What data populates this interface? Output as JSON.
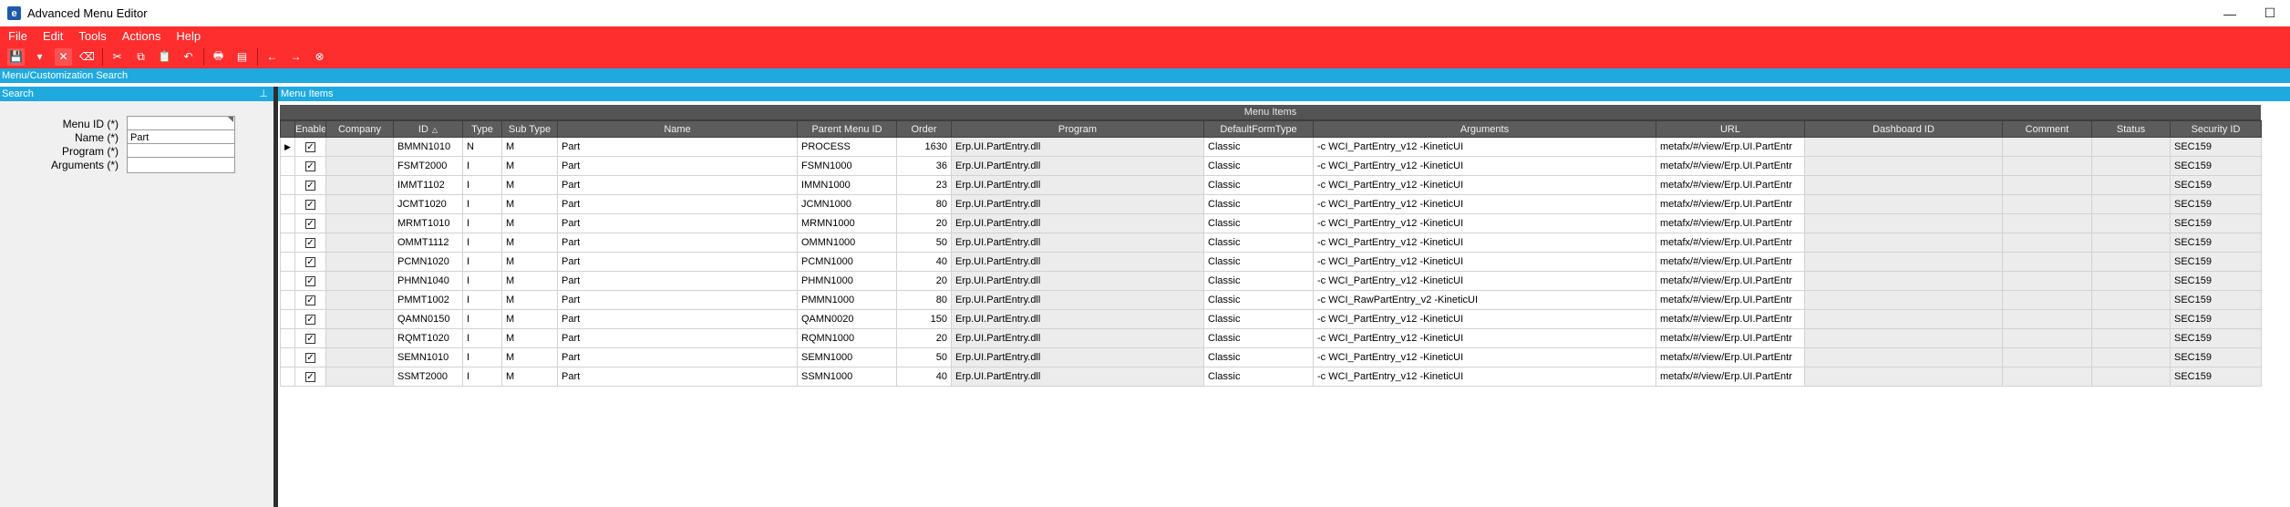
{
  "window": {
    "title": "Advanced Menu Editor",
    "app_icon_letter": "e",
    "minimize_glyph": "—",
    "maximize_glyph": "☐"
  },
  "menubar": [
    "File",
    "Edit",
    "Tools",
    "Actions",
    "Help"
  ],
  "toolbar": [
    {
      "name": "save-icon",
      "glyph": "💾",
      "boxed": true
    },
    {
      "name": "dropdown-arrow-icon",
      "glyph": "▾",
      "boxed": false
    },
    {
      "name": "clear-icon",
      "glyph": "✕",
      "boxed": true
    },
    {
      "name": "eraser-icon",
      "glyph": "⌫",
      "boxed": false
    },
    {
      "sep": true
    },
    {
      "name": "cut-icon",
      "glyph": "✂",
      "boxed": false
    },
    {
      "name": "copy-icon",
      "glyph": "⧉",
      "boxed": false
    },
    {
      "name": "paste-icon",
      "glyph": "📋",
      "boxed": false
    },
    {
      "name": "undo-icon",
      "glyph": "↶",
      "boxed": false
    },
    {
      "sep": true
    },
    {
      "name": "print-icon",
      "glyph": "🖶",
      "boxed": false
    },
    {
      "name": "print-preview-icon",
      "glyph": "▤",
      "boxed": false
    },
    {
      "sep": true
    },
    {
      "name": "back-icon",
      "glyph": "←",
      "boxed": false
    },
    {
      "name": "forward-icon",
      "glyph": "→",
      "boxed": false
    },
    {
      "name": "stop-icon",
      "glyph": "⊗",
      "boxed": false
    }
  ],
  "search_header": "Menu/Customization Search",
  "left_panel": {
    "title": "Search",
    "fields": [
      {
        "label": "Menu ID (*)",
        "value": "",
        "dropdown": true
      },
      {
        "label": "Name (*)",
        "value": "Part",
        "dropdown": false
      },
      {
        "label": "Program (*)",
        "value": "",
        "dropdown": false
      },
      {
        "label": "Arguments (*)",
        "value": "",
        "dropdown": false
      }
    ]
  },
  "right_panel": {
    "title": "Menu Items"
  },
  "grid": {
    "group_title": "Menu Items",
    "columns": [
      "",
      "Enabled",
      "Company",
      "ID",
      "Type",
      "Sub Type",
      "Name",
      "Parent Menu ID",
      "Order",
      "Program",
      "DefaultFormType",
      "Arguments",
      "URL",
      "Dashboard ID",
      "Comment",
      "Status",
      "Security ID"
    ],
    "sorted_column": "ID",
    "rows": [
      [
        "BMMN1010",
        "N",
        "M",
        "Part",
        "PROCESS",
        "1630",
        "Erp.UI.PartEntry.dll",
        "Classic",
        "-c WCI_PartEntry_v12 -KineticUI",
        "metafx/#/view/Erp.UI.PartEntr",
        "",
        "",
        "",
        "SEC159"
      ],
      [
        "FSMT2000",
        "I",
        "M",
        "Part",
        "FSMN1000",
        "36",
        "Erp.UI.PartEntry.dll",
        "Classic",
        "-c WCI_PartEntry_v12 -KineticUI",
        "metafx/#/view/Erp.UI.PartEntr",
        "",
        "",
        "",
        "SEC159"
      ],
      [
        "IMMT1102",
        "I",
        "M",
        "Part",
        "IMMN1000",
        "23",
        "Erp.UI.PartEntry.dll",
        "Classic",
        "-c WCI_PartEntry_v12 -KineticUI",
        "metafx/#/view/Erp.UI.PartEntr",
        "",
        "",
        "",
        "SEC159"
      ],
      [
        "JCMT1020",
        "I",
        "M",
        "Part",
        "JCMN1000",
        "80",
        "Erp.UI.PartEntry.dll",
        "Classic",
        "-c WCI_PartEntry_v12 -KineticUI",
        "metafx/#/view/Erp.UI.PartEntr",
        "",
        "",
        "",
        "SEC159"
      ],
      [
        "MRMT1010",
        "I",
        "M",
        "Part",
        "MRMN1000",
        "20",
        "Erp.UI.PartEntry.dll",
        "Classic",
        "-c WCI_PartEntry_v12 -KineticUI",
        "metafx/#/view/Erp.UI.PartEntr",
        "",
        "",
        "",
        "SEC159"
      ],
      [
        "OMMT1112",
        "I",
        "M",
        "Part",
        "OMMN1000",
        "50",
        "Erp.UI.PartEntry.dll",
        "Classic",
        "-c WCI_PartEntry_v12 -KineticUI",
        "metafx/#/view/Erp.UI.PartEntr",
        "",
        "",
        "",
        "SEC159"
      ],
      [
        "PCMN1020",
        "I",
        "M",
        "Part",
        "PCMN1000",
        "40",
        "Erp.UI.PartEntry.dll",
        "Classic",
        "-c WCI_PartEntry_v12 -KineticUI",
        "metafx/#/view/Erp.UI.PartEntr",
        "",
        "",
        "",
        "SEC159"
      ],
      [
        "PHMN1040",
        "I",
        "M",
        "Part",
        "PHMN1000",
        "20",
        "Erp.UI.PartEntry.dll",
        "Classic",
        "-c WCI_PartEntry_v12 -KineticUI",
        "metafx/#/view/Erp.UI.PartEntr",
        "",
        "",
        "",
        "SEC159"
      ],
      [
        "PMMT1002",
        "I",
        "M",
        "Part",
        "PMMN1000",
        "80",
        "Erp.UI.PartEntry.dll",
        "Classic",
        "-c WCI_RawPartEntry_v2 -KineticUI",
        "metafx/#/view/Erp.UI.PartEntr",
        "",
        "",
        "",
        "SEC159"
      ],
      [
        "QAMN0150",
        "I",
        "M",
        "Part",
        "QAMN0020",
        "150",
        "Erp.UI.PartEntry.dll",
        "Classic",
        "-c WCI_PartEntry_v12 -KineticUI",
        "metafx/#/view/Erp.UI.PartEntr",
        "",
        "",
        "",
        "SEC159"
      ],
      [
        "RQMT1020",
        "I",
        "M",
        "Part",
        "RQMN1000",
        "20",
        "Erp.UI.PartEntry.dll",
        "Classic",
        "-c WCI_PartEntry_v12 -KineticUI",
        "metafx/#/view/Erp.UI.PartEntr",
        "",
        "",
        "",
        "SEC159"
      ],
      [
        "SEMN1010",
        "I",
        "M",
        "Part",
        "SEMN1000",
        "50",
        "Erp.UI.PartEntry.dll",
        "Classic",
        "-c WCI_PartEntry_v12 -KineticUI",
        "metafx/#/view/Erp.UI.PartEntr",
        "",
        "",
        "",
        "SEC159"
      ],
      [
        "SSMT2000",
        "I",
        "M",
        "Part",
        "SSMN1000",
        "40",
        "Erp.UI.PartEntry.dll",
        "Classic",
        "-c WCI_PartEntry_v12 -KineticUI",
        "metafx/#/view/Erp.UI.PartEntr",
        "",
        "",
        "",
        "SEC159"
      ]
    ],
    "enabled_checked_glyph": "✓",
    "current_row_glyph": "▶",
    "sort_glyph": "△"
  },
  "colors": {
    "ribbon": "#ff2e2e",
    "panel_header": "#1eaadf",
    "grid_header": "#5c5c5c"
  }
}
